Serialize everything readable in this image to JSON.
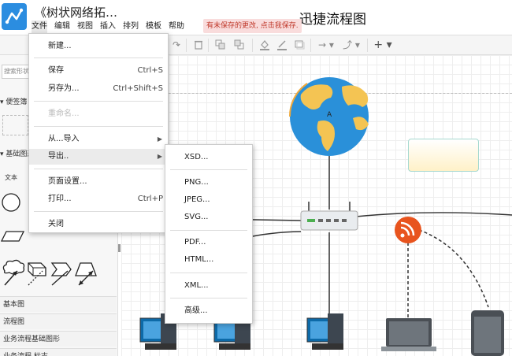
{
  "header": {
    "doc_title": "《树状网络拓…",
    "app_name": "迅捷流程图",
    "unsaved_notice": "有未保存的更改, 点击我保存.",
    "menubar": [
      "文件",
      "编辑",
      "视图",
      "插入",
      "排列",
      "模板",
      "帮助"
    ]
  },
  "sidebar": {
    "search_placeholder": "搜索形状",
    "scratchpad_label": "便签簿",
    "basic_shapes_label": "基础图形",
    "text_label": "文本",
    "categories": [
      "基本图",
      "流程图",
      "业务流程基础图形",
      "业务流程 标志"
    ]
  },
  "canvas": {
    "globe_label": "A"
  },
  "file_menu": {
    "new": "新建...",
    "save": "保存",
    "save_shortcut": "Ctrl+S",
    "save_as": "另存为...",
    "save_as_shortcut": "Ctrl+Shift+S",
    "rename": "重命名...",
    "import_from": "从...导入",
    "export": "导出..",
    "page_setup": "页面设置...",
    "print": "打印...",
    "print_shortcut": "Ctrl+P",
    "close": "关闭"
  },
  "export_submenu": {
    "xsd": "XSD...",
    "png": "PNG...",
    "jpeg": "JPEG...",
    "svg": "SVG...",
    "pdf": "PDF...",
    "html": "HTML...",
    "xml": "XML...",
    "advanced": "高级..."
  },
  "colors": {
    "accent": "#2b8de0",
    "unsaved_bg": "#f9dcdc",
    "unsaved_text": "#c0392b",
    "rss_orange": "#e8541e"
  }
}
